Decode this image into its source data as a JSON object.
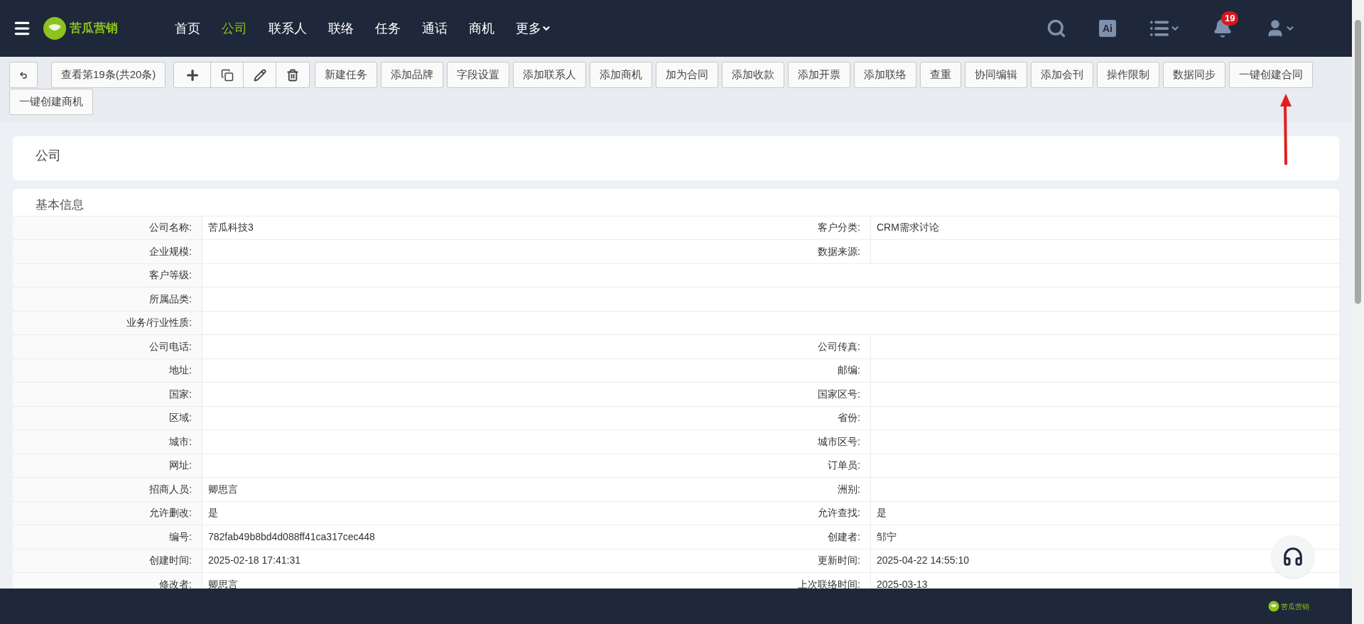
{
  "brand": "苦瓜营销",
  "nav": [
    {
      "label": "首页",
      "selected": false
    },
    {
      "label": "公司",
      "selected": true
    },
    {
      "label": "联系人",
      "selected": false
    },
    {
      "label": "联络",
      "selected": false
    },
    {
      "label": "任务",
      "selected": false
    },
    {
      "label": "通话",
      "selected": false
    },
    {
      "label": "商机",
      "selected": false
    },
    {
      "label": "更多",
      "selected": false,
      "dropdown": true
    }
  ],
  "ai_label": "Ai",
  "notification_count": "19",
  "toolbar": {
    "record_nav": "查看第19条(共20条)",
    "actions": [
      "新建任务",
      "添加品牌",
      "字段设置",
      "添加联系人",
      "添加商机",
      "加为合同",
      "添加收款",
      "添加开票",
      "添加联络",
      "查重",
      "协同编辑",
      "添加会刊",
      "操作限制",
      "数据同步",
      "一键创建合同",
      "一键创建商机"
    ]
  },
  "page_title": "公司",
  "section_title": "基本信息",
  "rows": [
    {
      "label": "公司名称:",
      "value": "苦瓜科技3",
      "label2": "客户分类:",
      "value2": "CRM需求讨论"
    },
    {
      "label": "企业规模:",
      "value": "",
      "label2": "数据来源:",
      "value2": ""
    },
    {
      "label": "客户等级:",
      "value": ""
    },
    {
      "label": "所属品类:",
      "value": ""
    },
    {
      "label": "业务/行业性质:",
      "value": ""
    },
    {
      "label": "公司电话:",
      "value": "",
      "label2": "公司传真:",
      "value2": ""
    },
    {
      "label": "地址:",
      "value": "",
      "label2": "邮编:",
      "value2": ""
    },
    {
      "label": "国家:",
      "value": "",
      "label2": "国家区号:",
      "value2": ""
    },
    {
      "label": "区域:",
      "value": "",
      "label2": "省份:",
      "value2": ""
    },
    {
      "label": "城市:",
      "value": "",
      "label2": "城市区号:",
      "value2": ""
    },
    {
      "label": "网址:",
      "value": "",
      "label2": "订单员:",
      "value2": ""
    },
    {
      "label": "招商人员:",
      "value": "卿思言",
      "label2": "洲别:",
      "value2": ""
    },
    {
      "label": "允许删改:",
      "value": "是",
      "label2": "允许查找:",
      "value2": "是"
    },
    {
      "label": "编号:",
      "value": "782fab49b8bd4d088ff41ca317cec448",
      "label2": "创建者:",
      "value2": "邹宁"
    },
    {
      "label": "创建时间:",
      "value": "2025-02-18 17:41:31",
      "label2": "更新时间:",
      "value2": "2025-04-22 14:55:10"
    },
    {
      "label": "修改者:",
      "value": "卿思言",
      "label2": "上次联络时间:",
      "value2": "2025-03-13"
    }
  ],
  "footer_brand": "苦瓜营销"
}
